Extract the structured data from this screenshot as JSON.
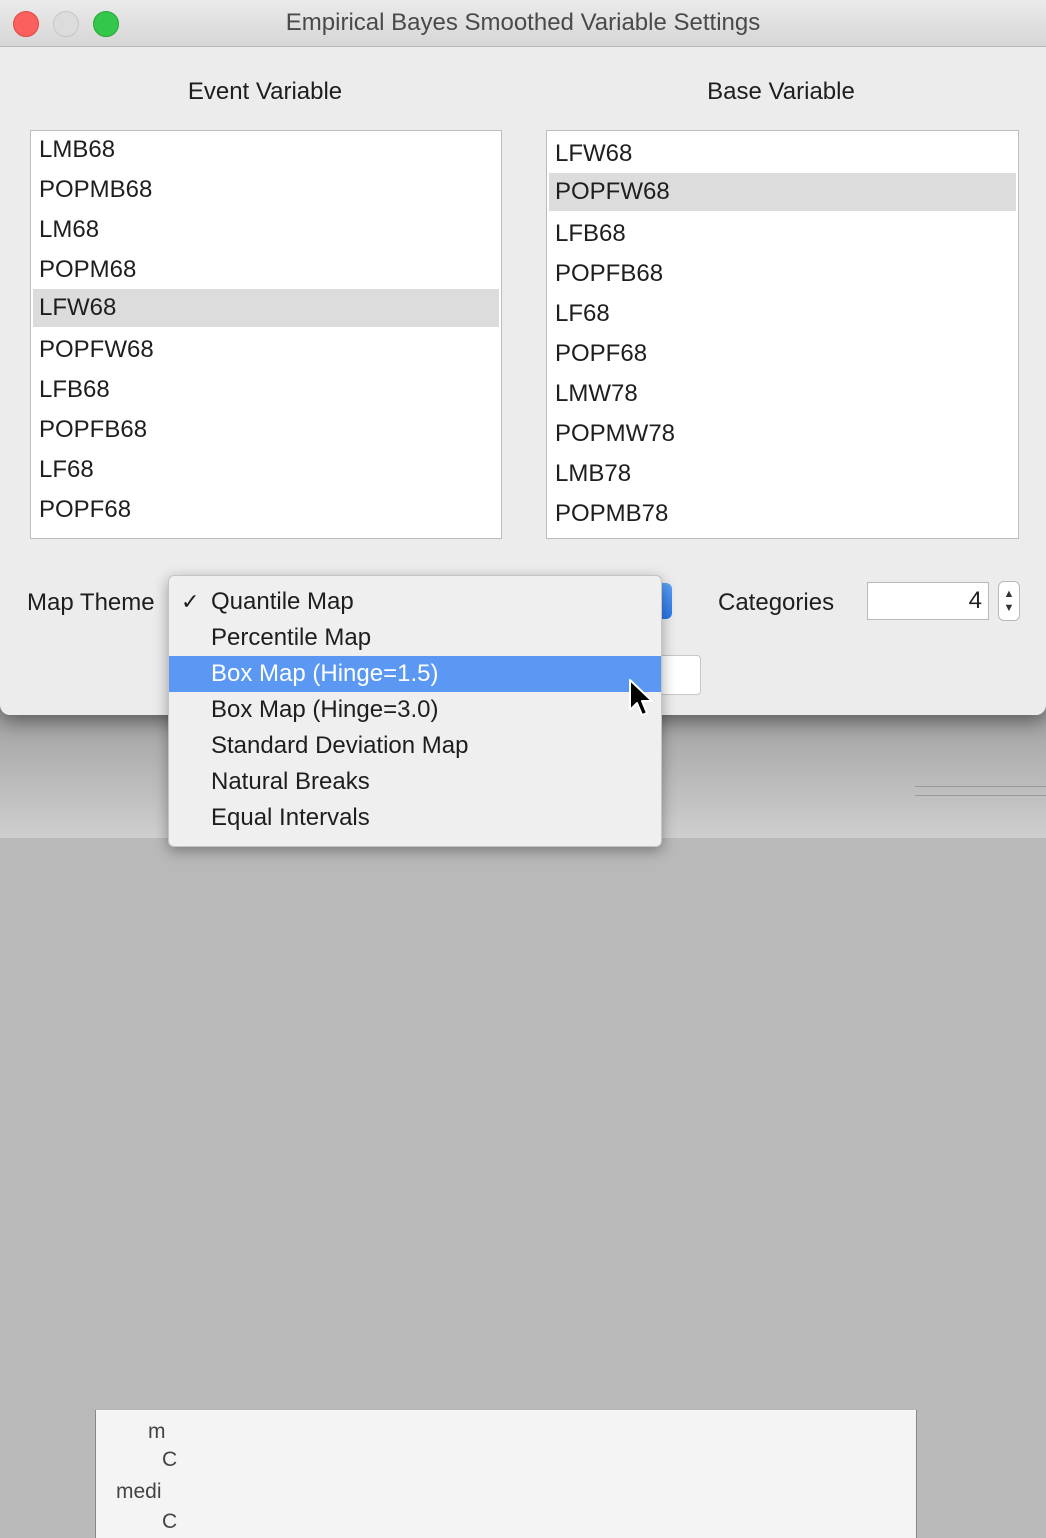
{
  "window": {
    "title": "Empirical Bayes Smoothed Variable Settings"
  },
  "event_variable": {
    "label": "Event Variable",
    "items": [
      "LMB68",
      "POPMB68",
      "LM68",
      "POPM68",
      "LFW68",
      "POPFW68",
      "LFB68",
      "POPFB68",
      "LF68",
      "POPF68"
    ],
    "selected": "LFW68"
  },
  "base_variable": {
    "label": "Base Variable",
    "items": [
      "LFW68",
      "POPFW68",
      "LFB68",
      "POPFB68",
      "LF68",
      "POPF68",
      "LMW78",
      "POPMW78",
      "LMB78",
      "POPMB78"
    ],
    "selected": "POPFW68"
  },
  "map_theme": {
    "label": "Map Theme",
    "options": [
      {
        "label": "Quantile Map",
        "checked": true
      },
      {
        "label": "Percentile Map"
      },
      {
        "label": "Box Map (Hinge=1.5)",
        "highlighted": true
      },
      {
        "label": "Box Map (Hinge=3.0)"
      },
      {
        "label": "Standard Deviation Map"
      },
      {
        "label": "Natural Breaks"
      },
      {
        "label": "Equal Intervals"
      }
    ]
  },
  "categories": {
    "label": "Categories",
    "value": "4"
  },
  "background_window": {
    "fragments": [
      "m",
      "C",
      "medi",
      "C"
    ]
  },
  "colors": {
    "highlight": "#5b98f3",
    "list_selected": "#dcdcdc",
    "close": "#fc605c",
    "maximize": "#34c84a"
  }
}
